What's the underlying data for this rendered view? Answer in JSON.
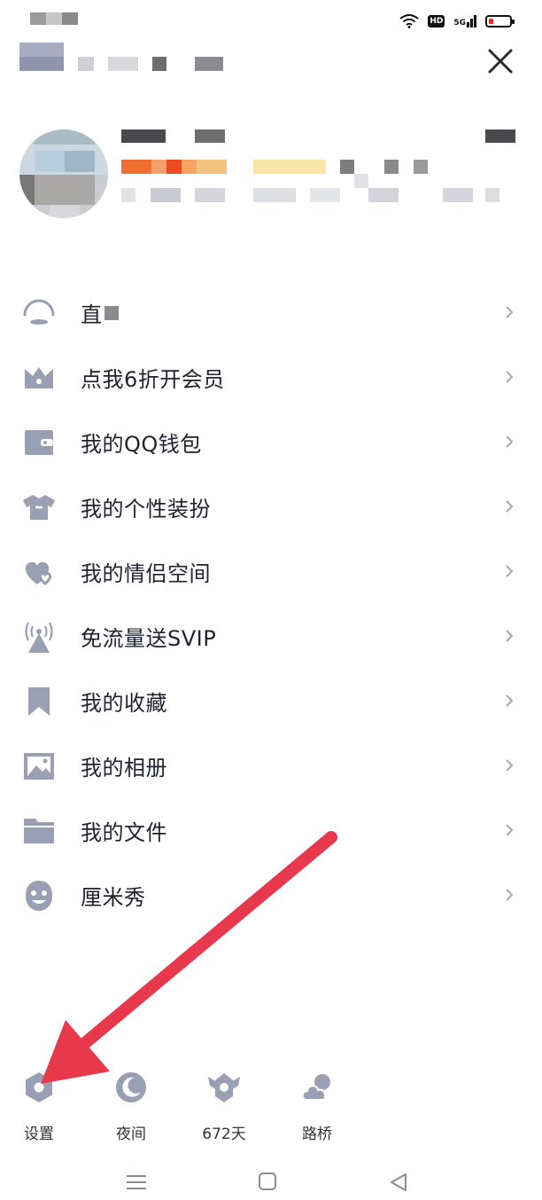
{
  "status_bar": {
    "hd": "HD",
    "network": "5G"
  },
  "menu": {
    "items": [
      {
        "label": "直",
        "icon": "live-icon"
      },
      {
        "label": "点我6折开会员",
        "icon": "crown-icon"
      },
      {
        "label": "我的QQ钱包",
        "icon": "wallet-icon"
      },
      {
        "label": "我的个性装扮",
        "icon": "shirt-icon"
      },
      {
        "label": "我的情侣空间",
        "icon": "hearts-icon"
      },
      {
        "label": "免流量送SVIP",
        "icon": "antenna-icon"
      },
      {
        "label": "我的收藏",
        "icon": "bookmark-icon"
      },
      {
        "label": "我的相册",
        "icon": "photo-icon"
      },
      {
        "label": "我的文件",
        "icon": "folder-icon"
      },
      {
        "label": "厘米秀",
        "icon": "face-icon"
      }
    ]
  },
  "bottom_actions": [
    {
      "label": "设置",
      "icon": "gear-icon"
    },
    {
      "label": "夜间",
      "icon": "moon-icon"
    },
    {
      "label": "672天",
      "icon": "badge-wings-icon"
    },
    {
      "label": "路桥",
      "icon": "cloud-icon"
    }
  ],
  "colors": {
    "icon": "#9aa0b4",
    "text": "#1f2230",
    "arrow": "#e8384c"
  }
}
